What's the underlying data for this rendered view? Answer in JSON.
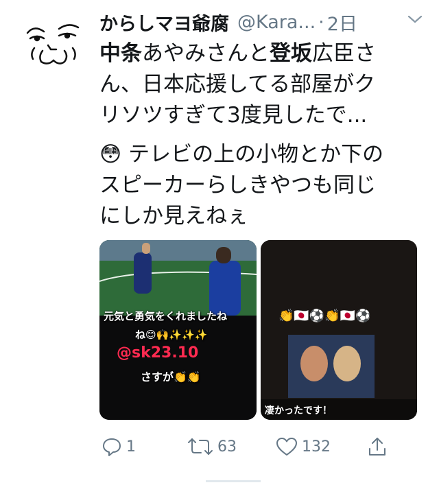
{
  "tweet": {
    "display_name": "からしマヨ爺腐",
    "handle": "@Kara...",
    "separator": "·",
    "time": "2日",
    "text_lines": [
      {
        "bold1": "中条",
        "plain1": "あやみさんと",
        "bold2": "登坂",
        "plain2": "広臣さ"
      },
      "ん、日本応援してる部屋がク",
      "リソツすぎて3度見したで...",
      "😳 テレビの上の小物とか下の",
      "スピーカーらしきやつも同じ",
      "にしか見えねぇ"
    ]
  },
  "media": {
    "left": {
      "line1": "元気と勇気をくれましたね",
      "line2": "ね😊🙌✨✨✨",
      "mention": "@sk23.10",
      "line4": "さすが👏👏"
    },
    "right": {
      "emojis": "👏🇯🇵⚽👏🇯🇵⚽",
      "caption": "凄かったです！"
    }
  },
  "actions": {
    "reply_count": "1",
    "retweet_count": "63",
    "like_count": "132"
  },
  "icons": {
    "avatar": "face-doodle-avatar",
    "caret": "chevron-down-icon",
    "reply": "reply-icon",
    "retweet": "retweet-icon",
    "like": "heart-icon",
    "share": "share-icon"
  },
  "colors": {
    "text": "#14171a",
    "secondary": "#657786",
    "mention": "#ff2a50"
  }
}
